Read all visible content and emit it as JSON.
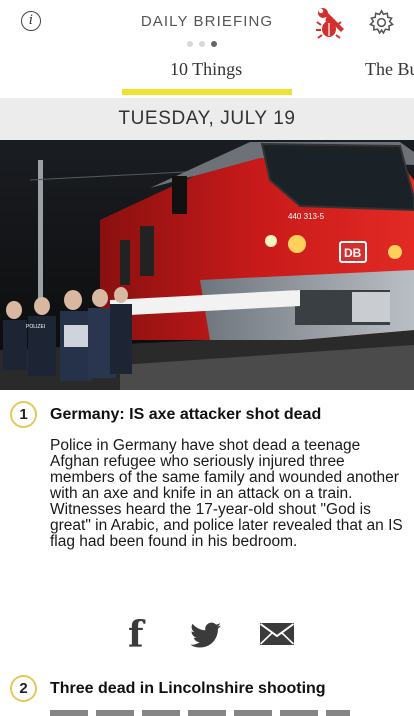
{
  "header": {
    "title": "DAILY BRIEFING",
    "info_icon_glyph": "i",
    "page_dots": {
      "count": 3,
      "active_index": 2
    },
    "icons": [
      "info-icon",
      "bug-wrench-icon",
      "gear-icon"
    ],
    "accent_color": "#d32f2f"
  },
  "tabs": [
    {
      "label": "10 Things",
      "active": true
    },
    {
      "label": "The Bu",
      "active": false
    }
  ],
  "date_label": "TUESDAY, JULY 19",
  "hero": {
    "train_number": "440 313-5",
    "logo_text": "DB",
    "police_label": "POLIZEI"
  },
  "stories": [
    {
      "number": "1",
      "title": "Germany: IS axe attacker shot dead",
      "body": "Police in Germany have shot dead a teenage Afghan refugee who seriously injured three members of the same family and wounded another with an axe and knife in an attack on a train. Witnesses heard the 17-year-old shout \"God is great\" in Arabic, and police later revealed that an IS flag had been found in his bedroom."
    },
    {
      "number": "2",
      "title": "Three dead in Lincolnshire shooting"
    }
  ],
  "share": {
    "facebook_glyph": "f",
    "icons": [
      "facebook-icon",
      "twitter-icon",
      "mail-icon"
    ]
  },
  "colors": {
    "badge_border": "#e6c75a",
    "tab_underline": "#f0e02f",
    "date_band": "#ececec"
  }
}
